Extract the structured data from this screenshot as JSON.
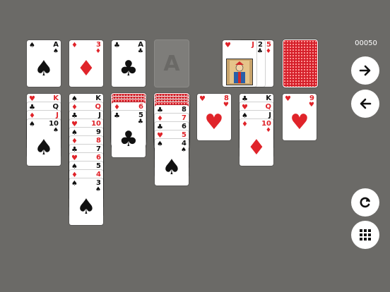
{
  "score": "00050",
  "suits": {
    "spade": "♠",
    "heart": "♥",
    "diamond": "♦",
    "club": "♣"
  },
  "foundation": [
    {
      "rank": "A",
      "suit": "♠",
      "color": "black"
    },
    {
      "rank": "3",
      "suit": "♦",
      "color": "red"
    },
    {
      "rank": "A",
      "suit": "♣",
      "color": "black"
    },
    {
      "rank": "A",
      "suit": "",
      "color": "empty"
    }
  ],
  "waste": [
    {
      "rank": "J",
      "suit": "♥",
      "color": "red"
    },
    {
      "rank": "2",
      "suit": "♣",
      "color": "black"
    },
    {
      "rank": "5",
      "suit": "♦",
      "color": "red"
    }
  ],
  "tableau": [
    [
      {
        "rank": "K",
        "suit": "♥",
        "color": "red"
      },
      {
        "rank": "Q",
        "suit": "♣",
        "color": "black"
      },
      {
        "rank": "J",
        "suit": "♦",
        "color": "red"
      },
      {
        "rank": "10",
        "suit": "♠",
        "color": "black"
      }
    ],
    [
      {
        "rank": "K",
        "suit": "♠",
        "color": "black"
      },
      {
        "rank": "Q",
        "suit": "♦",
        "color": "red"
      },
      {
        "rank": "J",
        "suit": "♣",
        "color": "black"
      },
      {
        "rank": "10",
        "suit": "♥",
        "color": "red"
      },
      {
        "rank": "9",
        "suit": "♠",
        "color": "black"
      },
      {
        "rank": "8",
        "suit": "♦",
        "color": "red"
      },
      {
        "rank": "7",
        "suit": "♣",
        "color": "black"
      },
      {
        "rank": "6",
        "suit": "♥",
        "color": "red"
      },
      {
        "rank": "5",
        "suit": "♠",
        "color": "black"
      },
      {
        "rank": "4",
        "suit": "♦",
        "color": "red"
      },
      {
        "rank": "3",
        "suit": "♠",
        "color": "black"
      }
    ],
    [
      {
        "rank": "6",
        "suit": "♦",
        "color": "red"
      },
      {
        "rank": "5",
        "suit": "♣",
        "color": "black"
      }
    ],
    [
      {
        "rank": "8",
        "suit": "♣",
        "color": "black"
      },
      {
        "rank": "7",
        "suit": "♦",
        "color": "red"
      },
      {
        "rank": "6",
        "suit": "♣",
        "color": "black"
      },
      {
        "rank": "5",
        "suit": "♥",
        "color": "red"
      },
      {
        "rank": "4",
        "suit": "♠",
        "color": "black"
      }
    ],
    [
      {
        "rank": "8",
        "suit": "♥",
        "color": "red"
      }
    ],
    [
      {
        "rank": "K",
        "suit": "♣",
        "color": "black"
      },
      {
        "rank": "Q",
        "suit": "♥",
        "color": "red"
      },
      {
        "rank": "J",
        "suit": "♠",
        "color": "black"
      },
      {
        "rank": "10",
        "suit": "♦",
        "color": "red"
      }
    ],
    [
      {
        "rank": "9",
        "suit": "♥",
        "color": "red"
      }
    ]
  ],
  "hidden_counts": [
    0,
    0,
    3,
    4,
    0,
    0,
    0
  ],
  "icons": {
    "next": "arrow-right-icon",
    "back": "arrow-left-icon",
    "restart": "restart-icon",
    "menu": "grid-menu-icon"
  }
}
